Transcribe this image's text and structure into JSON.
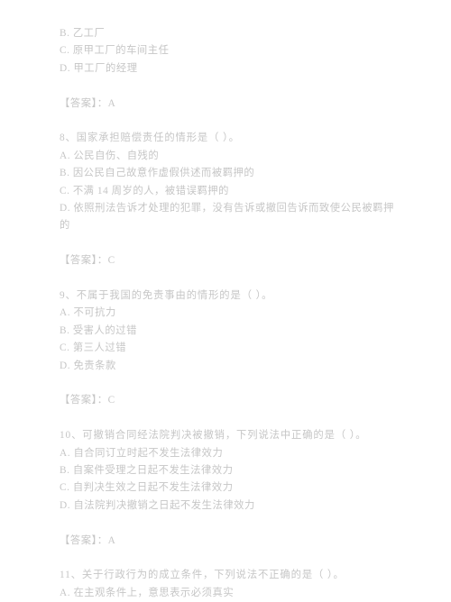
{
  "document": {
    "type": "exam-question-bank",
    "language": "zh-CN",
    "text_color": "#c6c6c6",
    "background_color": "#ffffff",
    "answer_label": "【答案】：",
    "blocks": [
      {
        "id": "q7-tail",
        "kind": "options-continued",
        "options": [
          "B. 乙工厂",
          "C. 原甲工厂的车间主任",
          "D. 甲工厂的经理"
        ]
      },
      {
        "id": "q7-answer",
        "kind": "answer",
        "text": "【答案】：A",
        "value": "A"
      },
      {
        "id": "q8",
        "kind": "question",
        "stem": "8、国家承担赔偿责任的情形是（      ）。",
        "number": "8",
        "options": [
          "A. 公民自伤、自残的",
          "B. 因公民自己故意作虚假供述而被羁押的",
          "C. 不满 14 周岁的人，被错误羁押的",
          "D. 依照刑法告诉才处理的犯罪，没有告诉或撤回告诉而致使公民被羁押的"
        ]
      },
      {
        "id": "q8-answer",
        "kind": "answer",
        "text": "【答案】：C",
        "value": "C"
      },
      {
        "id": "q9",
        "kind": "question",
        "stem": "9、不属于我国的免责事由的情形的是（      ）。",
        "number": "9",
        "options": [
          "A. 不可抗力",
          "B. 受害人的过错",
          "C. 第三人过错",
          "D. 免责条款"
        ]
      },
      {
        "id": "q9-answer",
        "kind": "answer",
        "text": "【答案】：C",
        "value": "C"
      },
      {
        "id": "q10",
        "kind": "question",
        "stem": "10、可撤销合同经法院判决被撤销，下列说法中正确的是（      ）。",
        "number": "10",
        "options": [
          "A. 自合同订立时起不发生法律效力",
          "B. 自案件受理之日起不发生法律效力",
          "C. 自判决生效之日起不发生法律效力",
          "D. 自法院判决撤销之日起不发生法律效力"
        ]
      },
      {
        "id": "q10-answer",
        "kind": "answer",
        "text": "【答案】：A",
        "value": "A"
      },
      {
        "id": "q11",
        "kind": "question",
        "stem": "11、关于行政行为的成立条件，下列说法不正确的是（      ）。",
        "number": "11",
        "options": [
          "A. 在主观条件上，意思表示必须真实"
        ]
      }
    ]
  }
}
